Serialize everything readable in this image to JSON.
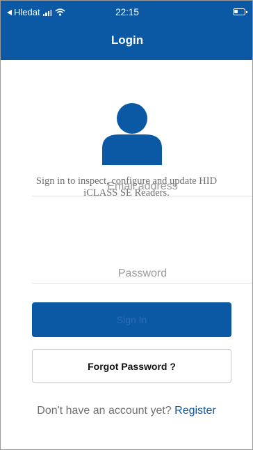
{
  "status_bar": {
    "back_label": "Hledat",
    "time": "22:15"
  },
  "header": {
    "title": "Login"
  },
  "description": {
    "line1": "Sign in to inspect, configure and update HID",
    "line2": "iCLASS SE Readers."
  },
  "form": {
    "email_placeholder": "Email address",
    "password_placeholder": "Password",
    "signin_label": "Sign In",
    "forgot_label": "Forgot Password ?"
  },
  "register": {
    "prompt": "Don't have an account yet?",
    "link_label": "Register"
  },
  "colors": {
    "brand_blue": "#0b58a4",
    "text_gray": "#6f6f6f",
    "border_gray": "#c9c9c9"
  }
}
